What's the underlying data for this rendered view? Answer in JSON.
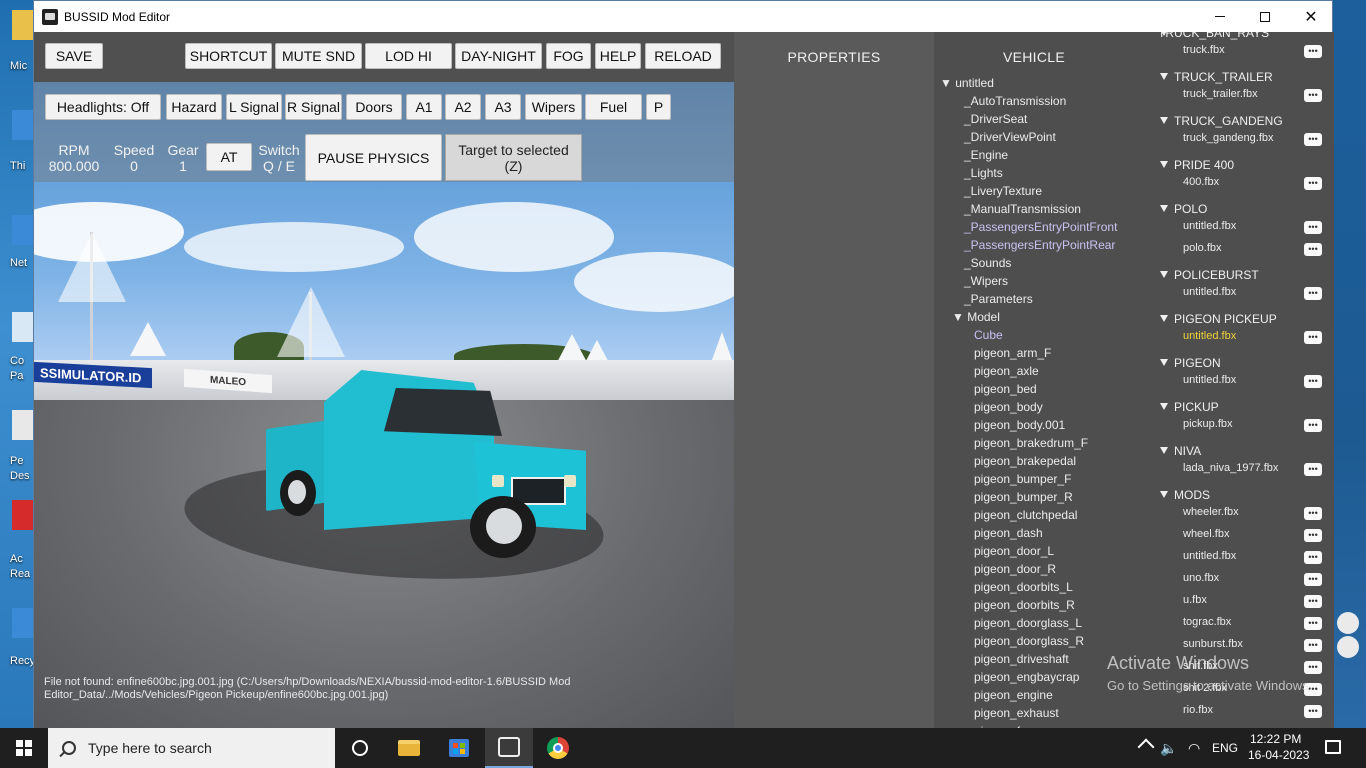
{
  "window": {
    "title": "BUSSID Mod Editor"
  },
  "desktop_labels": [
    "Mic",
    "Thi",
    "Net",
    "Co",
    "Pa",
    "Pe",
    "Des",
    "Ac",
    "Rea",
    "Recy"
  ],
  "toolbar": {
    "save": "SAVE",
    "shortcut": "SHORTCUT",
    "mute": "MUTE SND",
    "lod": "LOD HI",
    "daynight": "DAY-NIGHT",
    "fog": "FOG",
    "help": "HELP",
    "reload": "RELOAD"
  },
  "controls": {
    "headlights": "Headlights: Off",
    "hazard": "Hazard",
    "lsignal": "L Signal",
    "rsignal": "R Signal",
    "doors": "Doors",
    "a1": "A1",
    "a2": "A2",
    "a3": "A3",
    "wipers": "Wipers",
    "fuel": "Fuel",
    "p": "P"
  },
  "hud": {
    "rpm_label": "RPM",
    "rpm_value": "800.000",
    "speed_label": "Speed",
    "speed_value": "0",
    "gear_label": "Gear",
    "gear_value": "1",
    "at": "AT",
    "switch_label": "Switch",
    "switch_keys": "Q / E",
    "pause": "PAUSE PHYSICS",
    "target_line1": "Target to selected",
    "target_line2": "(Z)"
  },
  "scene": {
    "banner": "SSIMULATOR.ID",
    "banner2": "MALEO"
  },
  "error_message": "File not found: enfine600bc.jpg.001.jpg (C:/Users/hp/Downloads/NEXIA/bussid-mod-editor-1.6/BUSSID Mod Editor_Data/../Mods/Vehicles/Pigeon Pickeup/enfine600bc.jpg.001.jpg)",
  "properties_title": "PROPERTIES",
  "vehicle_title": "VEHICLE",
  "vehicle_tree": [
    {
      "label": "▼ untitled",
      "indent": 0,
      "style": ""
    },
    {
      "label": "_AutoTransmission",
      "indent": 2,
      "style": ""
    },
    {
      "label": "_DriverSeat",
      "indent": 2,
      "style": ""
    },
    {
      "label": "_DriverViewPoint",
      "indent": 2,
      "style": ""
    },
    {
      "label": "_Engine",
      "indent": 2,
      "style": ""
    },
    {
      "label": "_Lights",
      "indent": 2,
      "style": ""
    },
    {
      "label": "_LiveryTexture",
      "indent": 2,
      "style": ""
    },
    {
      "label": "_ManualTransmission",
      "indent": 2,
      "style": ""
    },
    {
      "label": "_PassengersEntryPointFront",
      "indent": 2,
      "style": "accent"
    },
    {
      "label": "_PassengersEntryPointRear",
      "indent": 2,
      "style": "accent"
    },
    {
      "label": "_Sounds",
      "indent": 2,
      "style": ""
    },
    {
      "label": "_Wipers",
      "indent": 2,
      "style": ""
    },
    {
      "label": "_Parameters",
      "indent": 2,
      "style": ""
    },
    {
      "label": "▼ Model",
      "indent": 1,
      "style": ""
    },
    {
      "label": "Cube",
      "indent": 3,
      "style": "highlight"
    },
    {
      "label": "pigeon_arm_F",
      "indent": 3,
      "style": ""
    },
    {
      "label": "pigeon_axle",
      "indent": 3,
      "style": ""
    },
    {
      "label": "pigeon_bed",
      "indent": 3,
      "style": ""
    },
    {
      "label": "pigeon_body",
      "indent": 3,
      "style": ""
    },
    {
      "label": "pigeon_body.001",
      "indent": 3,
      "style": ""
    },
    {
      "label": "pigeon_brakedrum_F",
      "indent": 3,
      "style": ""
    },
    {
      "label": "pigeon_brakepedal",
      "indent": 3,
      "style": ""
    },
    {
      "label": "pigeon_bumper_F",
      "indent": 3,
      "style": ""
    },
    {
      "label": "pigeon_bumper_R",
      "indent": 3,
      "style": ""
    },
    {
      "label": "pigeon_clutchpedal",
      "indent": 3,
      "style": ""
    },
    {
      "label": "pigeon_dash",
      "indent": 3,
      "style": ""
    },
    {
      "label": "pigeon_door_L",
      "indent": 3,
      "style": ""
    },
    {
      "label": "pigeon_door_R",
      "indent": 3,
      "style": ""
    },
    {
      "label": "pigeon_doorbits_L",
      "indent": 3,
      "style": ""
    },
    {
      "label": "pigeon_doorbits_R",
      "indent": 3,
      "style": ""
    },
    {
      "label": "pigeon_doorglass_L",
      "indent": 3,
      "style": ""
    },
    {
      "label": "pigeon_doorglass_R",
      "indent": 3,
      "style": ""
    },
    {
      "label": "pigeon_driveshaft",
      "indent": 3,
      "style": ""
    },
    {
      "label": "pigeon_engbaycrap",
      "indent": 3,
      "style": ""
    },
    {
      "label": "pigeon_engine",
      "indent": 3,
      "style": ""
    },
    {
      "label": "pigeon_exhaust",
      "indent": 3,
      "style": ""
    },
    {
      "label": "pigeon_fan",
      "indent": 3,
      "style": ""
    }
  ],
  "mods": {
    "partial_head": "TRUCK_BAN_RAYS",
    "partial_item": "truck.fbx",
    "groups": [
      {
        "name": "TRUCK_TRAILER",
        "items": [
          "truck_trailer.fbx"
        ]
      },
      {
        "name": "TRUCK_GANDENG",
        "items": [
          "truck_gandeng.fbx"
        ]
      },
      {
        "name": "PRIDE 400",
        "items": [
          "400.fbx"
        ]
      },
      {
        "name": "POLO",
        "items": [
          "untitled.fbx",
          "polo.fbx"
        ]
      },
      {
        "name": "POLICEBURST",
        "items": [
          "untitled.fbx"
        ]
      },
      {
        "name": "PIGEON PICKEUP",
        "items": [
          "untitled.fbx"
        ]
      },
      {
        "name": "PIGEON",
        "items": [
          "untitled.fbx"
        ]
      },
      {
        "name": "PICKUP",
        "items": [
          "pickup.fbx"
        ]
      },
      {
        "name": "NIVA",
        "items": [
          "lada_niva_1977.fbx"
        ]
      },
      {
        "name": "MODS",
        "items": [
          "wheeler.fbx",
          "wheel.fbx",
          "untitled.fbx",
          "uno.fbx",
          "u.fbx",
          "tograc.fbx",
          "sunburst.fbx",
          "shit.fbx",
          "shit 2.fbx",
          "rio.fbx"
        ]
      }
    ],
    "dots_label": "•••",
    "active_color": "#f2d23a"
  },
  "watermark": {
    "line1": "Activate Windows",
    "line2": "Go to Settings to activate Windows."
  },
  "taskbar": {
    "search_placeholder": "Type here to search",
    "lang": "ENG",
    "time": "12:22 PM",
    "date": "16-04-2023"
  }
}
